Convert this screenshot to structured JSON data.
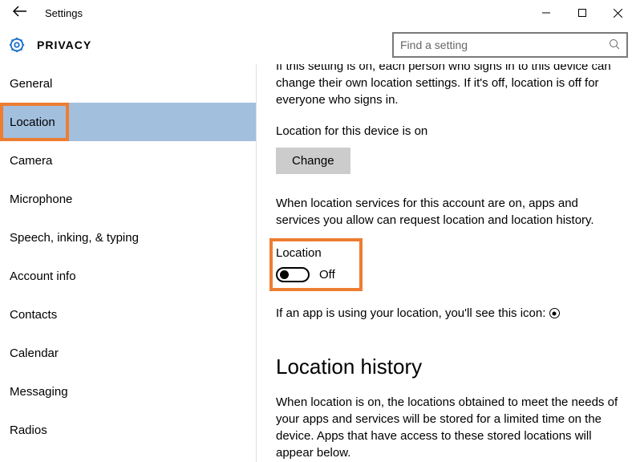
{
  "window": {
    "title": "Settings"
  },
  "header": {
    "title": "PRIVACY",
    "search_placeholder": "Find a setting"
  },
  "sidebar": {
    "items": [
      {
        "label": "General"
      },
      {
        "label": "Location",
        "selected": true,
        "highlighted": true
      },
      {
        "label": "Camera"
      },
      {
        "label": "Microphone"
      },
      {
        "label": "Speech, inking, & typing"
      },
      {
        "label": "Account info"
      },
      {
        "label": "Contacts"
      },
      {
        "label": "Calendar"
      },
      {
        "label": "Messaging"
      },
      {
        "label": "Radios"
      }
    ]
  },
  "content": {
    "truncated_intro": "If this setting is on, each person who signs in to this device can change their own location settings. If it's off, location is off for everyone who signs in.",
    "device_status": "Location for this device is on",
    "change_button": "Change",
    "account_desc": "When location services for this account are on, apps and services you allow can request location and location history.",
    "toggle": {
      "label": "Location",
      "state": "Off"
    },
    "icon_line": "If an app is using your location, you'll see this icon:",
    "history": {
      "title": "Location history",
      "body": "When location is on, the locations obtained to meet the needs of your apps and services will be stored for a limited time on the device. Apps that have access to these stored locations will appear below."
    }
  }
}
